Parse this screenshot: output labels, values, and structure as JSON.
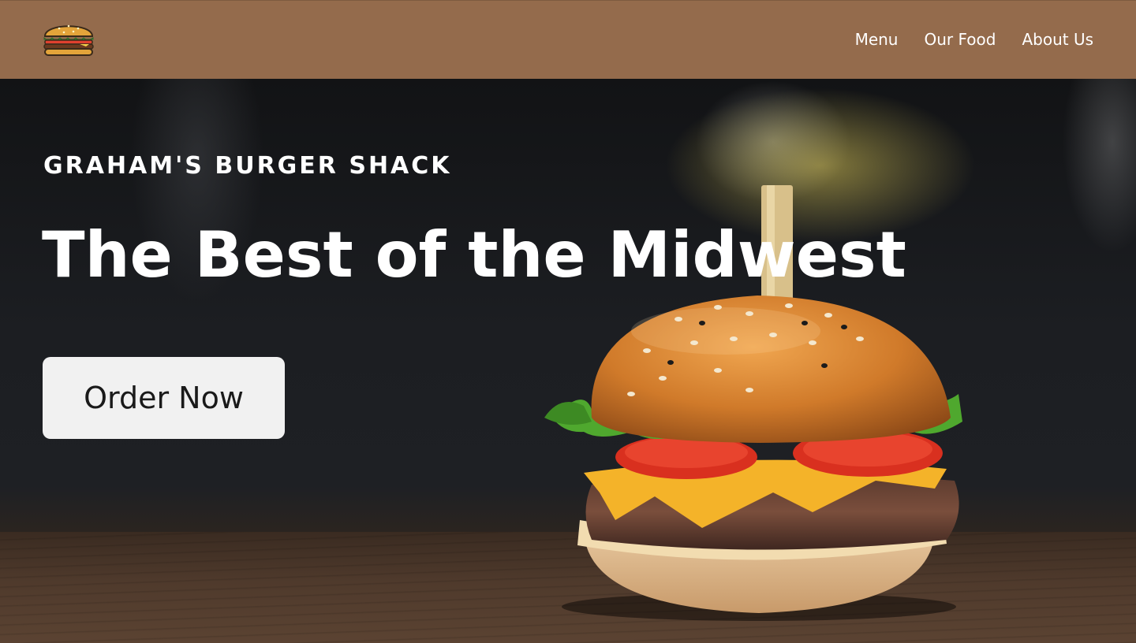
{
  "header": {
    "logo_icon": "hamburger-icon",
    "background": "#946b4c",
    "nav": [
      {
        "label": "Menu"
      },
      {
        "label": "Our Food"
      },
      {
        "label": "About Us"
      }
    ]
  },
  "hero": {
    "kicker": "GRAHAM'S BURGER SHACK",
    "headline": "The Best of the Midwest",
    "cta_label": "Order Now",
    "background_image": "burger-photo"
  }
}
